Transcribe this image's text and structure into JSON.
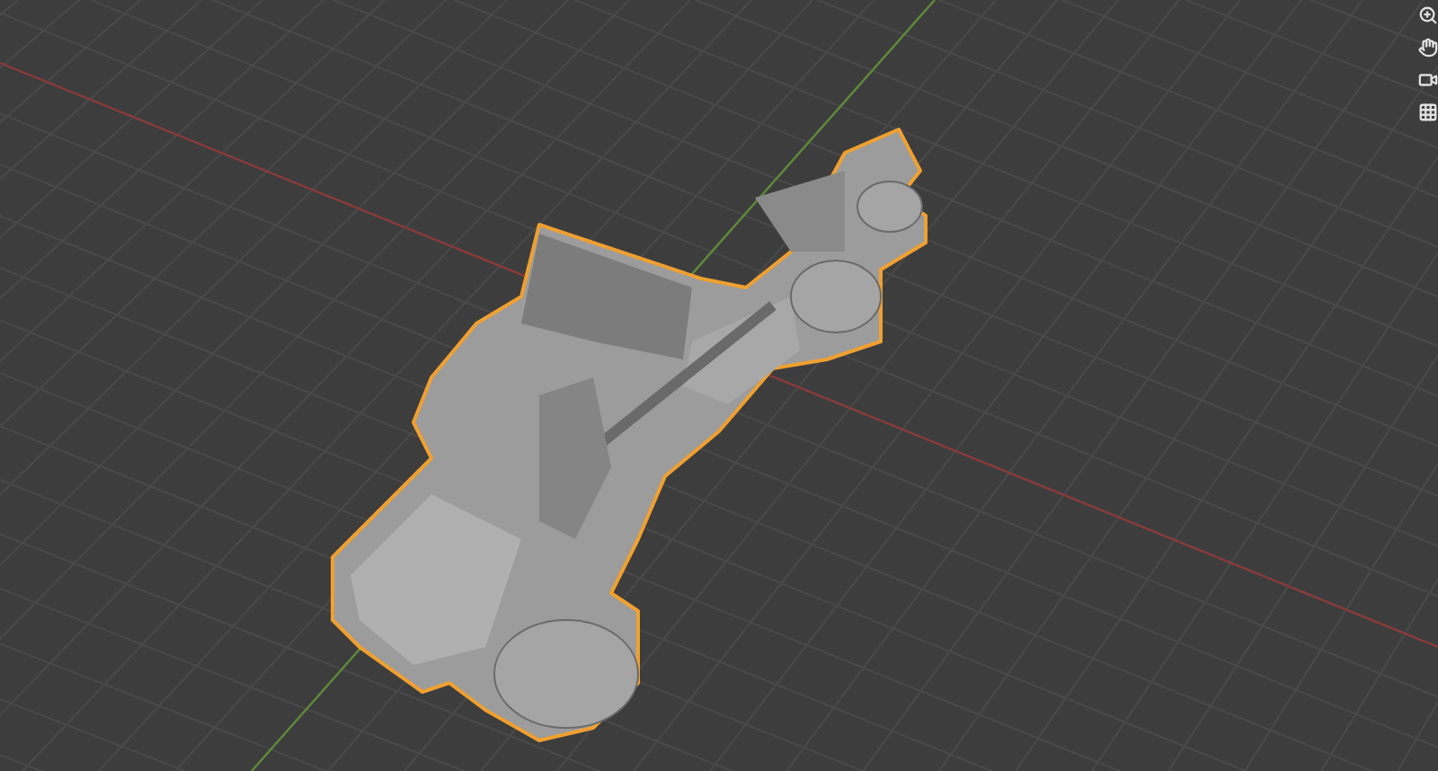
{
  "viewport": {
    "navigation_tools": [
      {
        "kind": "zoom"
      },
      {
        "kind": "pan"
      },
      {
        "kind": "camera"
      },
      {
        "kind": "grid"
      }
    ]
  }
}
